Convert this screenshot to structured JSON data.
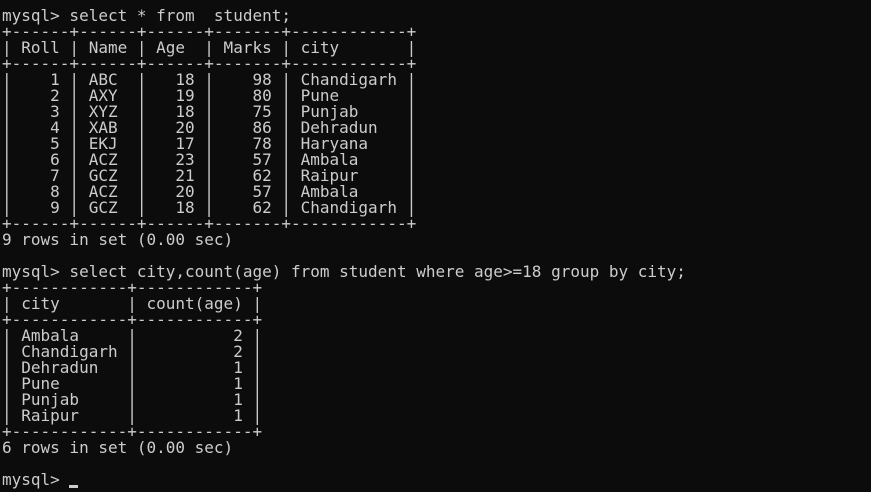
{
  "terminal": {
    "colors": {
      "background": "#0c0c0c",
      "text": "#cccccc"
    },
    "lines": [
      "mysql> select * from  student;",
      "+------+------+------+-------+------------+",
      "| Roll | Name | Age  | Marks | city       |",
      "+------+------+------+-------+------------+",
      "|    1 | ABC  |   18 |    98 | Chandigarh |",
      "|    2 | AXY  |   19 |    80 | Pune       |",
      "|    3 | XYZ  |   18 |    75 | Punjab     |",
      "|    4 | XAB  |   20 |    86 | Dehradun   |",
      "|    5 | EKJ  |   17 |    78 | Haryana    |",
      "|    6 | ACZ  |   23 |    57 | Ambala     |",
      "|    7 | GCZ  |   21 |    62 | Raipur     |",
      "|    8 | ACZ  |   20 |    57 | Ambala     |",
      "|    9 | GCZ  |   18 |    62 | Chandigarh |",
      "+------+------+------+-------+------------+",
      "9 rows in set (0.00 sec)",
      "",
      "mysql> select city,count(age) from student where age>=18 group by city;",
      "+------------+------------+",
      "| city       | count(age) |",
      "+------------+------------+",
      "| Ambala     |          2 |",
      "| Chandigarh |          2 |",
      "| Dehradun   |          1 |",
      "| Pune       |          1 |",
      "| Punjab     |          1 |",
      "| Raipur     |          1 |",
      "+------------+------------+",
      "6 rows in set (0.00 sec)",
      "",
      "mysql> "
    ]
  }
}
